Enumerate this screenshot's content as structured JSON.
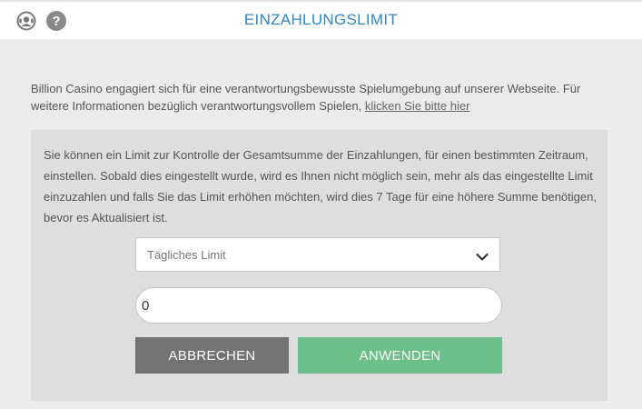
{
  "header": {
    "title": "EINZAHLUNGSLIMIT",
    "help_glyph": "?"
  },
  "icons": {
    "support": "support-agent-icon",
    "help": "question-circle-icon",
    "dropdown": "chevron-down-icon"
  },
  "intro": {
    "text": "Billion Casino engagiert sich für eine verantwortungsbewusste Spielumgebung auf unserer Webseite. Für weitere Informationen bezüglich verantwortungsvollem Spielen, ",
    "link_text": "klicken Sie bitte hier"
  },
  "panel": {
    "description": "Sie können ein Limit zur Kontrolle der Gesamtsumme der Einzahlungen, für einen bestimmten Zeitraum, einstellen. Sobald dies eingestellt wurde, wird es Ihnen nicht möglich sein, mehr als das eingestellte Limit einzuzahlen und falls Sie das Limit erhöhen möchten, wird dies 7 Tage für eine höhere Summe benötigen, bevor es Aktualisiert ist.",
    "limit_select": {
      "selected": "Tägliches Limit"
    },
    "amount_input": {
      "value": "0"
    },
    "cancel_label": "ABBRECHEN",
    "apply_label": "ANWENDEN"
  },
  "colors": {
    "title_blue": "#2f87c9",
    "apply_green": "#6dbf8a",
    "cancel_gray": "#737373",
    "page_bg": "#ebebeb",
    "panel_bg": "#dedede"
  }
}
